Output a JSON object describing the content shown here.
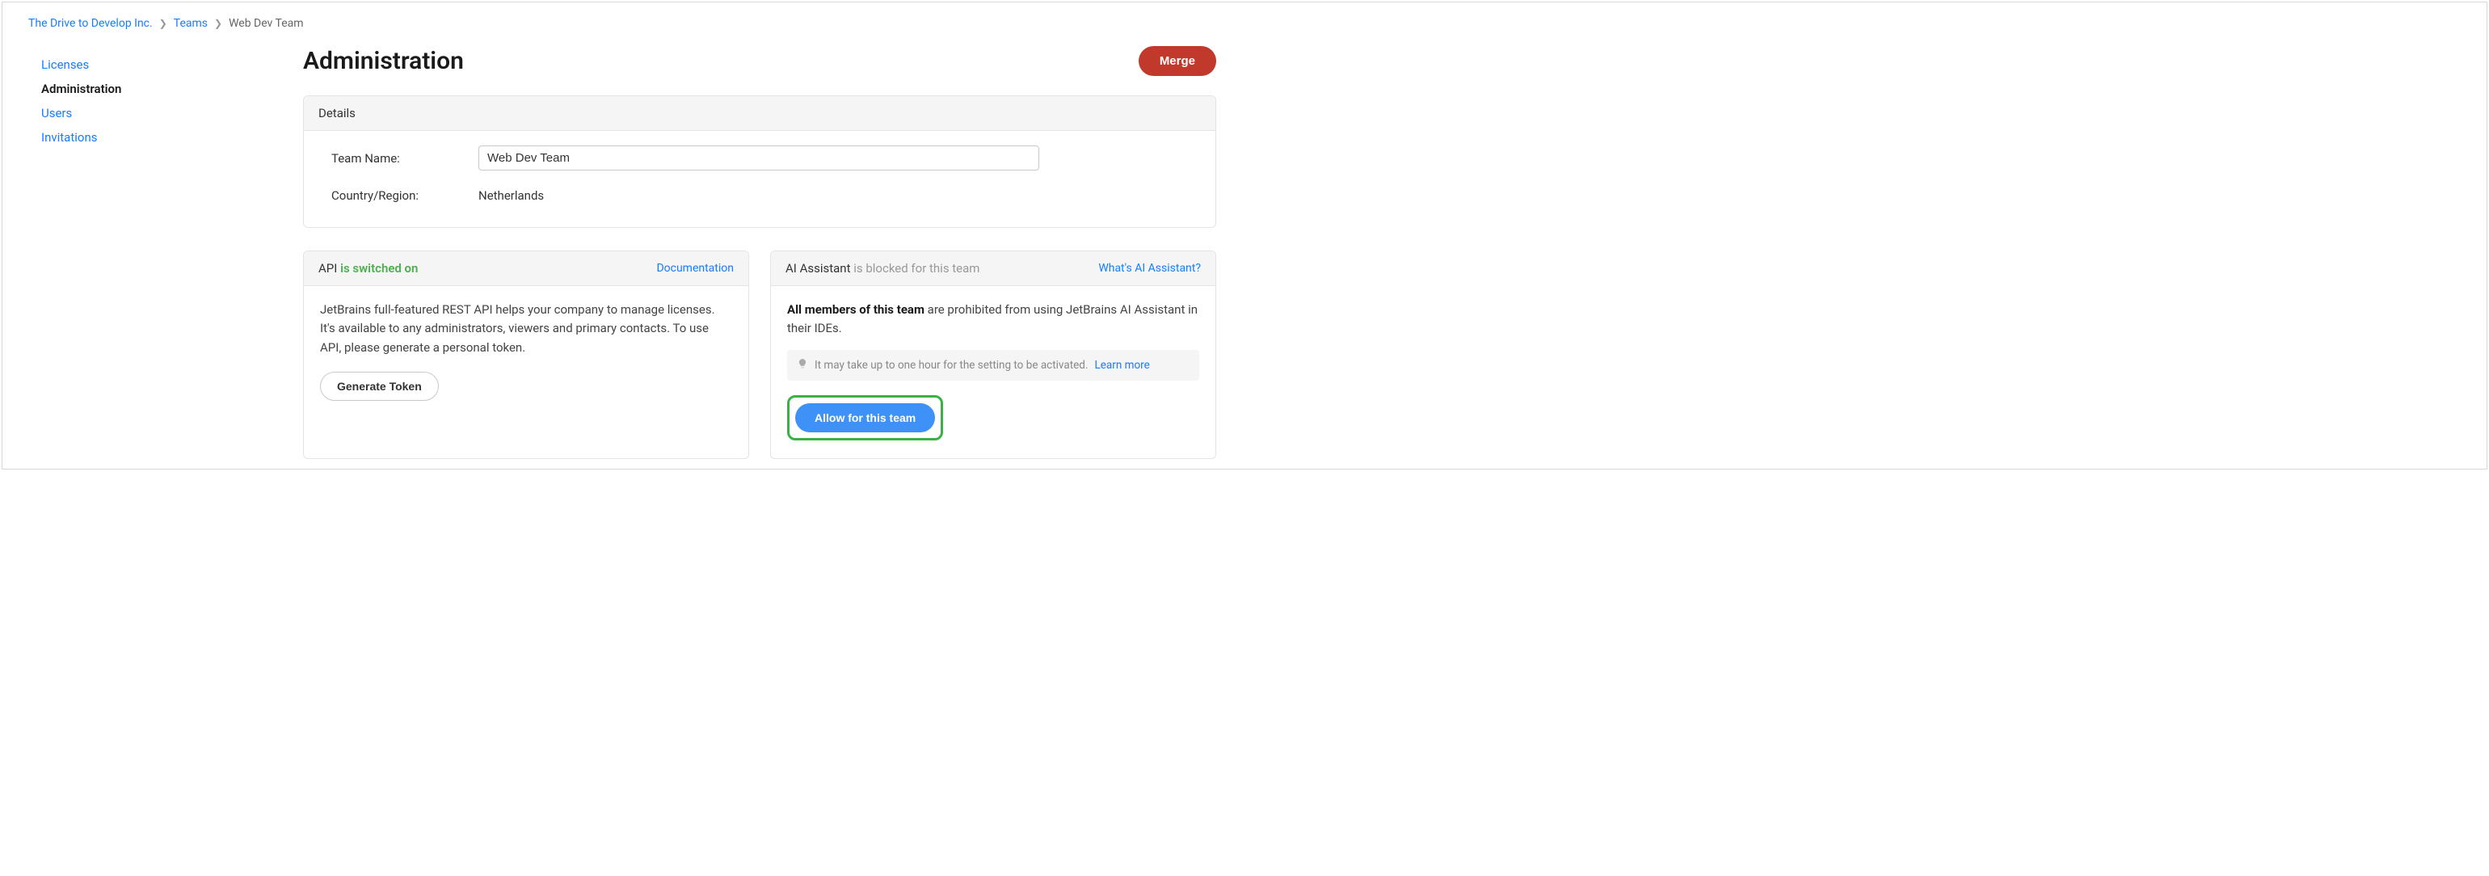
{
  "breadcrumb": {
    "org": "The Drive to Develop Inc.",
    "section": "Teams",
    "current": "Web Dev Team"
  },
  "sidebar": {
    "items": [
      {
        "label": "Licenses"
      },
      {
        "label": "Administration"
      },
      {
        "label": "Users"
      },
      {
        "label": "Invitations"
      }
    ]
  },
  "page": {
    "title": "Administration",
    "merge_label": "Merge"
  },
  "details": {
    "header": "Details",
    "team_name_label": "Team Name:",
    "team_name_value": "Web Dev Team",
    "country_label": "Country/Region:",
    "country_value": "Netherlands"
  },
  "api": {
    "label": "API",
    "status": "is switched on",
    "doc_link": "Documentation",
    "description": "JetBrains full-featured REST API helps your company to manage licenses. It's available to any administrators, viewers and primary contacts. To use API, please generate a personal token.",
    "generate_token": "Generate Token"
  },
  "ai": {
    "label": "AI Assistant",
    "status": "is blocked for this team",
    "what_link": "What's AI Assistant?",
    "desc_bold": "All members of this team",
    "desc_rest": " are prohibited from using JetBrains AI Assistant in their IDEs.",
    "info_text": "It may take up to one hour for the setting to be activated.",
    "learn_more": "Learn more",
    "allow_label": "Allow for this team"
  }
}
